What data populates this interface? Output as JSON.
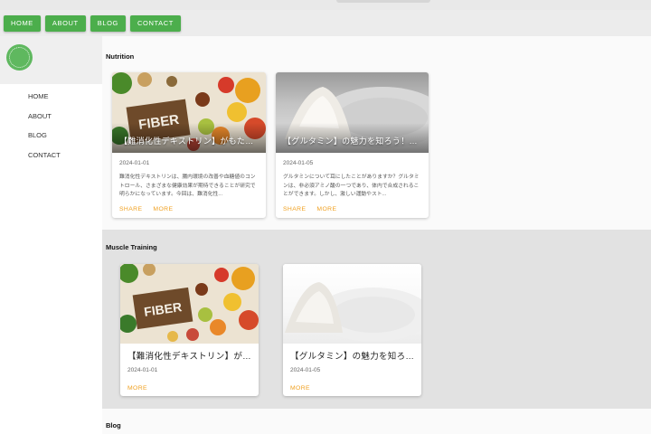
{
  "nav": {
    "home": "HOME",
    "about": "ABOUT",
    "blog": "BLOG",
    "contact": "CONTACT"
  },
  "sidebar": {
    "items": [
      {
        "label": "HOME"
      },
      {
        "label": "ABOUT"
      },
      {
        "label": "BLOG"
      },
      {
        "label": "CONTACT"
      }
    ]
  },
  "sections": {
    "nutrition": {
      "title": "Nutrition",
      "cards": [
        {
          "title": "【難消化性デキストリン】がもたら...",
          "date": "2024-01-01",
          "excerpt": "難消化性デキストリンは、腸内環境の改善や血糖値のコントロール、さまざまな健康効果が期待できることが研究で明らかになっています。今回は、難消化性...",
          "share": "SHARE",
          "more": "MORE",
          "image_text": "FIBER"
        },
        {
          "title": "【グルタミン】の魅力を知ろう！免...",
          "date": "2024-01-05",
          "excerpt": "グルタミンについて耳にしたことがありますか？グルタミンは、非必須アミノ酸の一つであり、体内で合成されることができます。しかし、激しい運動やスト...",
          "share": "SHARE",
          "more": "MORE"
        }
      ]
    },
    "muscle": {
      "title": "Muscle Training",
      "cards": [
        {
          "title": "【難消化性デキストリン】がも...",
          "date": "2024-01-01",
          "more": "MORE",
          "image_text": "FIBER"
        },
        {
          "title": "【グルタミン】の魅力を知ろう...",
          "date": "2024-01-05",
          "more": "MORE"
        }
      ]
    },
    "blog": {
      "title": "Blog"
    }
  },
  "colors": {
    "nav_green": "#4cae4c",
    "action_orange": "#f0a020"
  }
}
